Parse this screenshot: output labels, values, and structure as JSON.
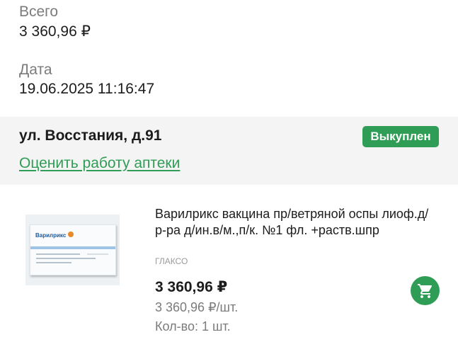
{
  "order": {
    "total_label": "Всего",
    "total_value": "3 360,96 ₽",
    "date_label": "Дата",
    "date_value": "19.06.2025 11:16:47"
  },
  "pharmacy": {
    "address": "ул. Восстания, д.91",
    "status": "Выкуплен",
    "rate_link": "Оценить работу аптеки"
  },
  "product": {
    "image_brand": "Варилрикс",
    "name": "Варилрикс вакцина пр/ветряной оспы лиоф.д/р-ра д/ин.в/м.,п/к. №1 фл. +раств.шпр",
    "manufacturer": "ГЛАКСО",
    "price_total": "3 360,96 ₽",
    "unit_price": "3 360,96 ₽/шт.",
    "quantity": "Кол-во: 1 шт.",
    "cart_icon": "shopping-cart-icon"
  },
  "colors": {
    "accent": "#2f9d55",
    "muted_text": "#7b7b7b",
    "band_background": "#f4f4f4"
  }
}
